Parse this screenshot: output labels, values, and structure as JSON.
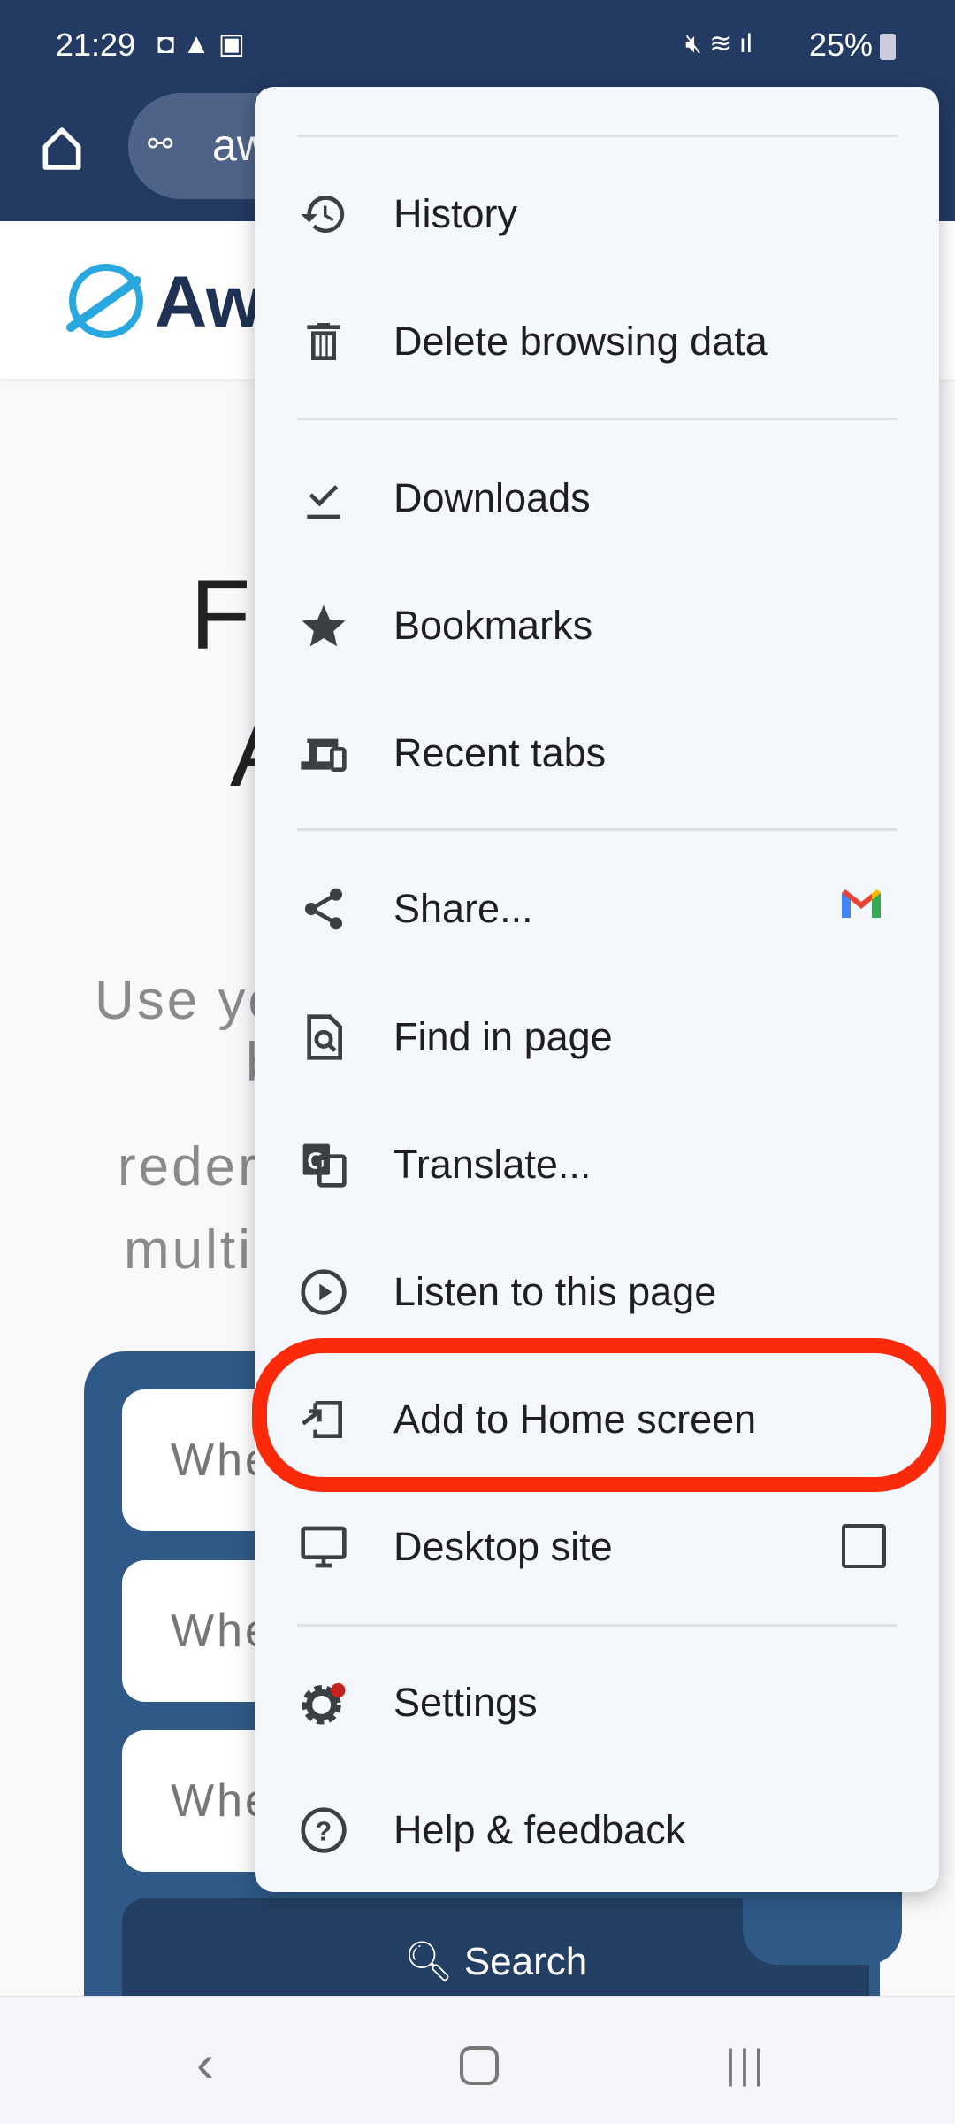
{
  "status_bar": {
    "time": "21:29",
    "battery": "25%"
  },
  "browser": {
    "url_partial": "aw"
  },
  "page": {
    "logo_text": "Aw",
    "hero_lines": [
      "Fi",
      "A"
    ],
    "subtitle_lines": [
      "Use yo",
      "b",
      "reder",
      "multi"
    ],
    "fields": [
      "Whe",
      "Whe",
      "Whe"
    ],
    "search_label": "Search"
  },
  "menu": {
    "items": [
      {
        "label": "History",
        "icon": "history-icon"
      },
      {
        "label": "Delete browsing data",
        "icon": "trash-icon"
      },
      {
        "label": "Downloads",
        "icon": "download-icon"
      },
      {
        "label": "Bookmarks",
        "icon": "star-icon"
      },
      {
        "label": "Recent tabs",
        "icon": "devices-icon"
      },
      {
        "label": "Share...",
        "icon": "share-icon"
      },
      {
        "label": "Find in page",
        "icon": "find-in-page-icon"
      },
      {
        "label": "Translate...",
        "icon": "translate-icon"
      },
      {
        "label": "Listen to this page",
        "icon": "play-circle-icon"
      },
      {
        "label": "Add to Home screen",
        "icon": "add-to-home-icon"
      },
      {
        "label": "Desktop site",
        "icon": "monitor-icon",
        "checked": false
      },
      {
        "label": "Settings",
        "icon": "settings-icon"
      },
      {
        "label": "Help & feedback",
        "icon": "help-icon"
      }
    ],
    "highlighted": "Add to Home screen",
    "highlight_color": "#fa2a0a"
  }
}
